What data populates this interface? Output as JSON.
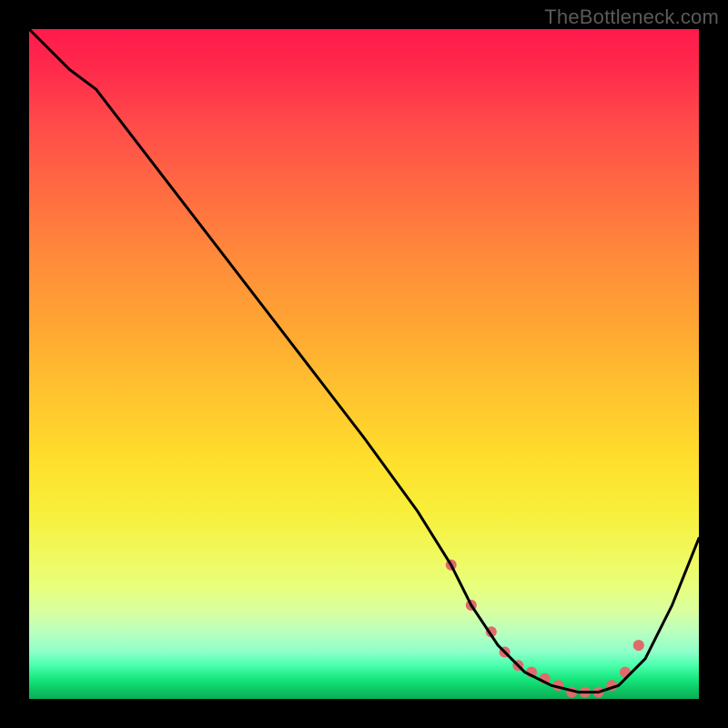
{
  "watermark": "TheBottleneck.com",
  "chart_data": {
    "type": "line",
    "title": "",
    "xlabel": "",
    "ylabel": "",
    "xlim": [
      0,
      100
    ],
    "ylim": [
      0,
      100
    ],
    "series": [
      {
        "name": "curve",
        "x": [
          0,
          6,
          10,
          20,
          30,
          40,
          50,
          58,
          63,
          66,
          70,
          74,
          78,
          82,
          85,
          88,
          92,
          96,
          100
        ],
        "y": [
          100,
          94,
          91,
          78,
          65,
          52,
          39,
          28,
          20,
          14,
          8,
          4,
          2,
          1,
          1,
          2,
          6,
          14,
          24
        ],
        "color": "#000000"
      }
    ],
    "markers": {
      "name": "valley-dots",
      "color": "#e06b6b",
      "radius_px": 6,
      "x": [
        63,
        66,
        69,
        71,
        73,
        75,
        77,
        79,
        81,
        83,
        85,
        87,
        89,
        91
      ],
      "y": [
        20,
        14,
        10,
        7,
        5,
        4,
        3,
        2,
        1,
        1,
        1,
        2,
        4,
        8
      ]
    }
  }
}
